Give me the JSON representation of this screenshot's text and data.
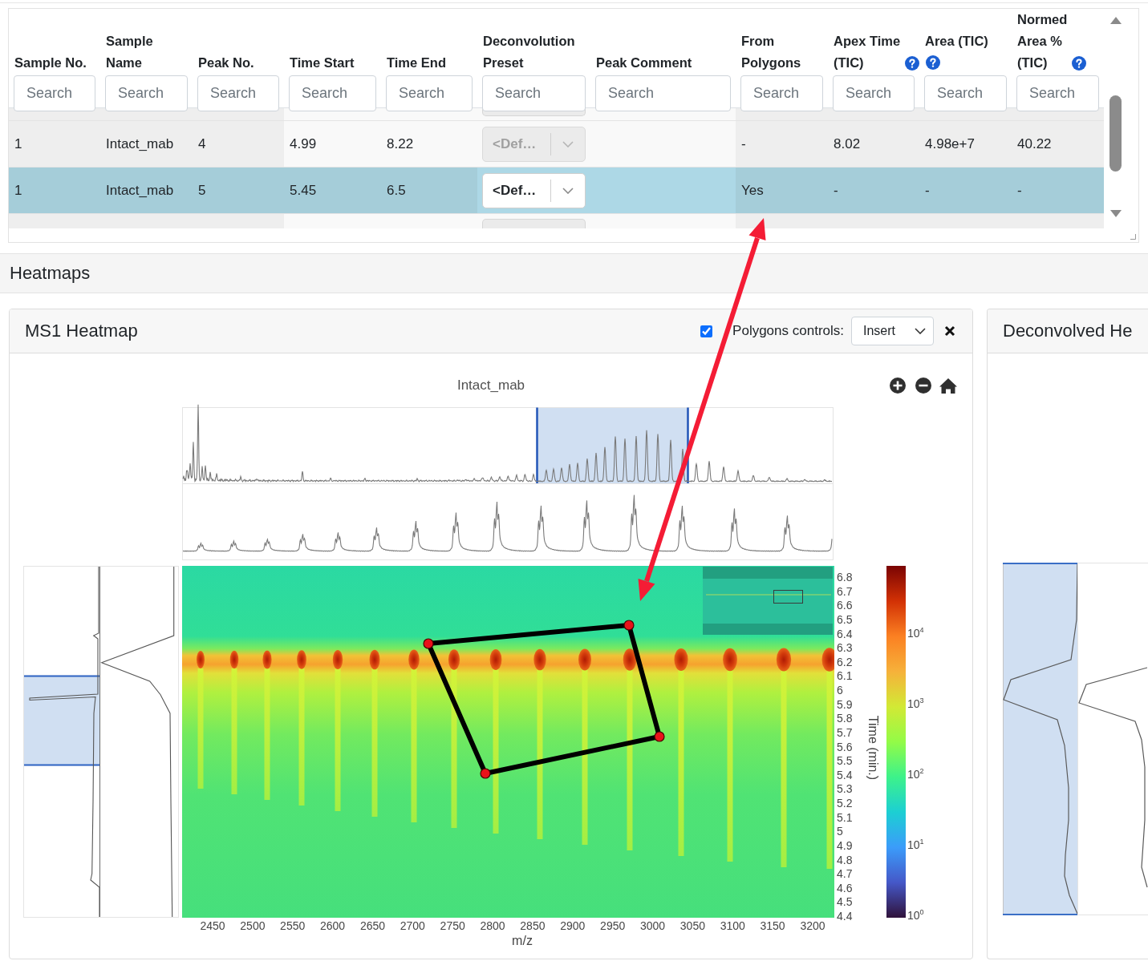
{
  "table": {
    "columns": [
      {
        "label": "Sample No.",
        "help": false,
        "placeholder": "Search"
      },
      {
        "label": "Sample Name",
        "help": false,
        "placeholder": "Search"
      },
      {
        "label": "Peak No.",
        "help": false,
        "placeholder": "Search"
      },
      {
        "label": "Time Start",
        "help": false,
        "placeholder": "Search"
      },
      {
        "label": "Time End",
        "help": false,
        "placeholder": "Search"
      },
      {
        "label": "Deconvolution Preset",
        "help": false,
        "placeholder": "Search"
      },
      {
        "label": "Peak Comment",
        "help": false,
        "placeholder": "Search"
      },
      {
        "label": "From Polygons",
        "help": false,
        "placeholder": "Search"
      },
      {
        "label": "Apex Time (TIC)",
        "help": true,
        "placeholder": "Search"
      },
      {
        "label": "Area (TIC)",
        "help": true,
        "placeholder": "Search"
      },
      {
        "label": "Normed Area % (TIC)",
        "help": true,
        "placeholder": "Search"
      }
    ],
    "rows": [
      {
        "selected": false,
        "sample_no": "1",
        "sample_name": "Intact_mab",
        "peak_no": "4",
        "time_start": "4.99",
        "time_end": "8.22",
        "deconvolution_preset": {
          "value": "<Def…",
          "disabled": true
        },
        "from_polygons": "-",
        "apex_time_tic": "8.02",
        "area_tic": "4.98e+7",
        "normed_area_tic": "40.22"
      },
      {
        "selected": true,
        "sample_no": "1",
        "sample_name": "Intact_mab",
        "peak_no": "5",
        "time_start": "5.45",
        "time_end": "6.5",
        "deconvolution_preset": {
          "value": "<Def…",
          "disabled": false
        },
        "from_polygons": "Yes",
        "apex_time_tic": "-",
        "area_tic": "-",
        "normed_area_tic": "-"
      }
    ]
  },
  "heatmaps": {
    "title": "Heatmaps",
    "panels": [
      {
        "kind": "ms1",
        "title": "MS1 Heatmap",
        "polygons_controls": {
          "checked": true,
          "label": "Polygons controls:",
          "mode": "Insert"
        },
        "plot": {
          "title": "Intact_mab",
          "x_ticks": [
            "2450",
            "2500",
            "2550",
            "2600",
            "2650",
            "2700",
            "2750",
            "2800",
            "2850",
            "2900",
            "2950",
            "3000",
            "3050",
            "3100",
            "3150",
            "3200"
          ],
          "x_label": "m/z",
          "y_ticks": [
            "6.8",
            "6.7",
            "6.6",
            "6.5",
            "6.4",
            "6.3",
            "6.2",
            "6.1",
            "6",
            "5.9",
            "5.8",
            "5.7",
            "5.6",
            "5.5",
            "5.4",
            "5.3",
            "5.2",
            "5.1",
            "5",
            "4.9",
            "4.8",
            "4.7",
            "4.6",
            "4.5",
            "4.4"
          ],
          "y_label": "Time (min.)",
          "colorbar_ticks": [
            "10$^{4}$",
            "10$^{3}$",
            "10$^{2}$",
            "10$^{1}$",
            "10$^{0}$"
          ]
        }
      },
      {
        "kind": "deconvolved",
        "title": "Deconvolved He"
      }
    ]
  }
}
